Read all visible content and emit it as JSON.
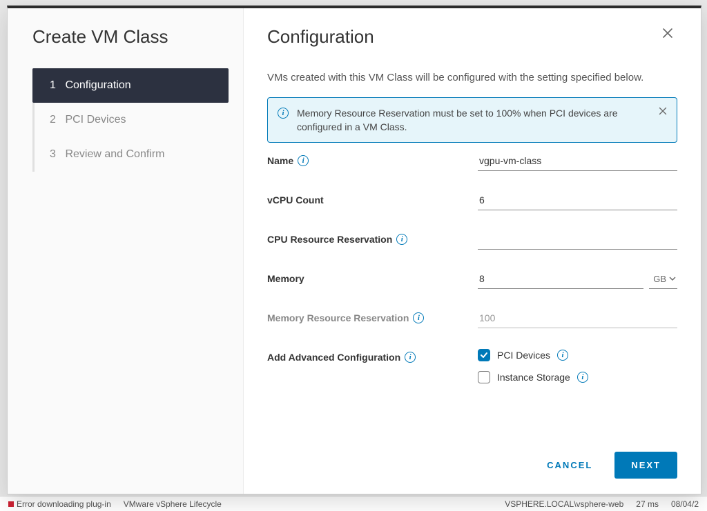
{
  "sidebar": {
    "title": "Create VM Class",
    "steps": [
      {
        "num": "1",
        "label": "Configuration",
        "active": true
      },
      {
        "num": "2",
        "label": "PCI Devices",
        "active": false
      },
      {
        "num": "3",
        "label": "Review and Confirm",
        "active": false
      }
    ]
  },
  "main": {
    "title": "Configuration",
    "description": "VMs created with this VM Class will be configured with the setting specified below."
  },
  "banner": {
    "text": "Memory Resource Reservation must be set to 100% when PCI devices are configured in a VM Class."
  },
  "form": {
    "name_label": "Name",
    "name_value": "vgpu-vm-class",
    "vcpu_label": "vCPU Count",
    "vcpu_value": "6",
    "cpu_res_label": "CPU Resource Reservation",
    "cpu_res_value": "",
    "memory_label": "Memory",
    "memory_value": "8",
    "memory_unit": "GB",
    "mem_res_label": "Memory Resource Reservation",
    "mem_res_value": "100",
    "advanced_label": "Add Advanced Configuration",
    "option_pci": "PCI Devices",
    "option_instorage": "Instance Storage",
    "pci_checked": true,
    "instorage_checked": false
  },
  "footer": {
    "cancel": "CANCEL",
    "next": "NEXT"
  },
  "background_status": {
    "a": "Error downloading plug-in",
    "b": "VMware vSphere Lifecycle",
    "c": "VSPHERE.LOCAL\\vsphere-web",
    "d": "27 ms",
    "e": "08/04/2"
  }
}
